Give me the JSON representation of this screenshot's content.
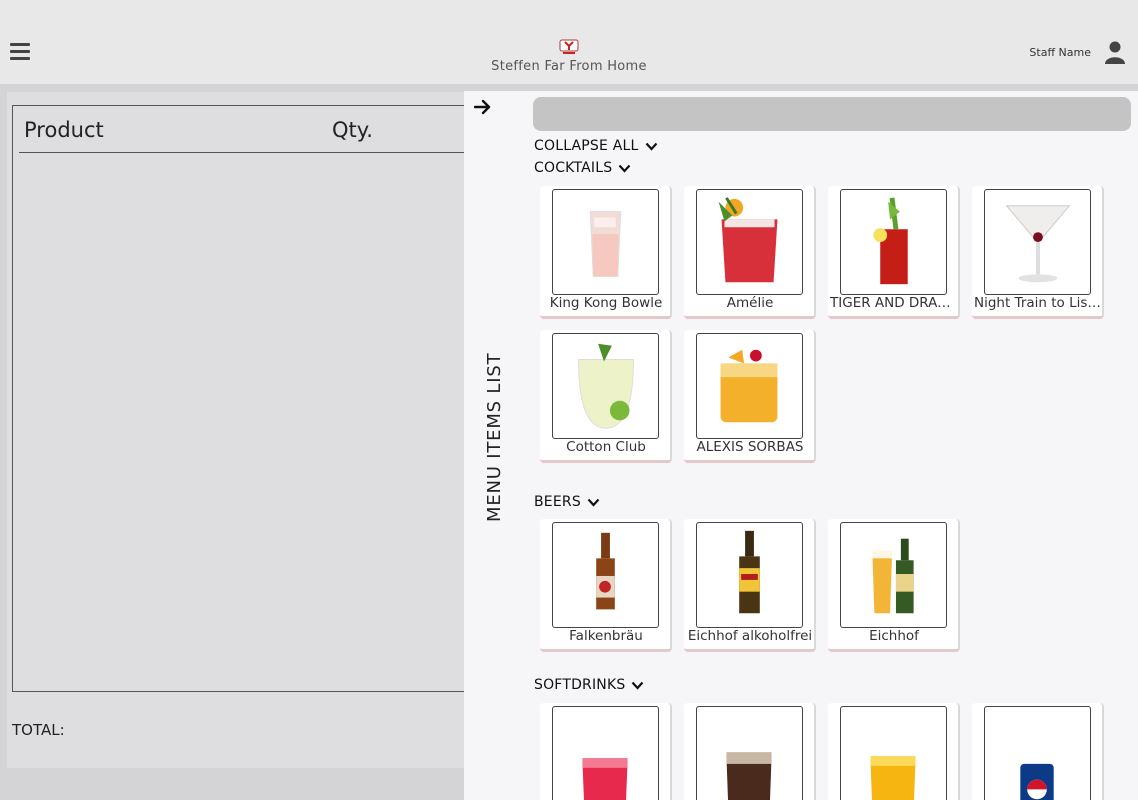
{
  "header": {
    "shop_name": "Steffen Far From Home",
    "staff_name": "Staff Name"
  },
  "order": {
    "col_product": "Product",
    "col_qty": "Qty.",
    "total_label": "TOTAL:"
  },
  "menu": {
    "title": "MENU ITEMS LIST",
    "search_placeholder": "",
    "collapse_all": "COLLAPSE ALL",
    "categories": [
      {
        "name": "COCKTAILS",
        "items": [
          "King Kong Bowle",
          "Amélie",
          "TIGER AND DRAGON",
          "Night Train to Lisbon",
          "Cotton Club",
          "ALEXIS SORBAS"
        ]
      },
      {
        "name": "BEERS",
        "items": [
          "Falkenbräu",
          "Eichhof alkoholfrei",
          "Eichhof"
        ]
      },
      {
        "name": "SOFTDRINKS",
        "items": [
          "",
          "",
          "",
          ""
        ]
      }
    ]
  }
}
